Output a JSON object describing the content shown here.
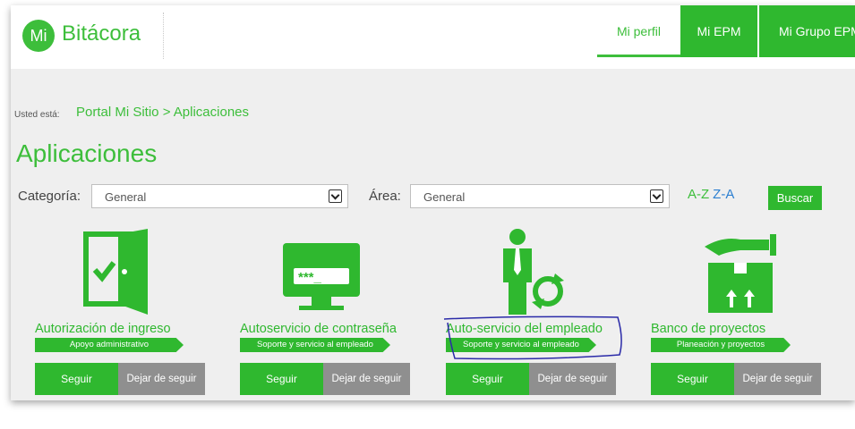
{
  "header": {
    "logo_mark": "Mi",
    "logo_text": "Bitácora",
    "nav": [
      "Mi perfil",
      "Mi EPM",
      "Mi Grupo EPM"
    ]
  },
  "breadcrumb": {
    "prefix": "Usted está:",
    "path": "Portal Mi Sitio > Aplicaciones"
  },
  "page_title": "Aplicaciones",
  "filters": {
    "categoria_label": "Categoría:",
    "categoria_value": "General",
    "area_label": "Área:",
    "area_value": "General",
    "az": "A-Z",
    "za": "Z-A",
    "search_button": "Buscar"
  },
  "apps": [
    {
      "name": "Autorización de ingreso",
      "category": "Apoyo administrativo",
      "icon": "door-check-icon"
    },
    {
      "name": "Autoservicio de contraseña",
      "category": "Soporte y servicio al empleado",
      "icon": "password-monitor-icon"
    },
    {
      "name": "Auto-servicio del empleado",
      "category": "Soporte y servicio al empleado",
      "icon": "employee-refresh-icon"
    },
    {
      "name": "Banco de proyectos",
      "category": "Planeación y proyectos",
      "icon": "box-hand-icon"
    }
  ],
  "follow_label": "Seguir",
  "unfollow_label": "Dejar de seguir",
  "colors": {
    "brand_green": "#2fb82f",
    "gray_button": "#8f8f8f",
    "link_blue": "#2c7fd1",
    "annotation": "#2a2aa8"
  }
}
